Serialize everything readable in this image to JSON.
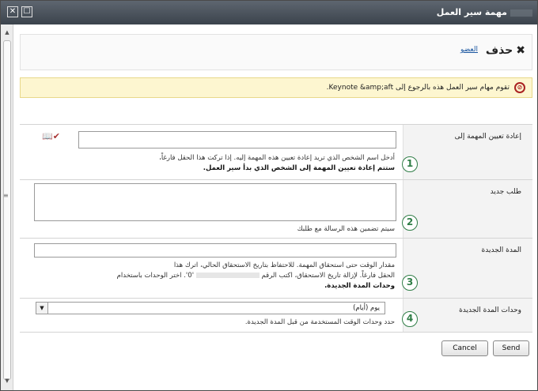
{
  "window": {
    "title": "مهمة سير العمل",
    "close_glyph": "✕",
    "max_glyph": "☐"
  },
  "ribbon": {
    "delete_label": "حذف",
    "member_link": "العضو"
  },
  "notice": {
    "text": "تقوم مهام سير العمل هذه بالرجوع إلى Keynote &amp;aft."
  },
  "form": {
    "reassign": {
      "label": "إعادة تعيين المهمة إلى",
      "value": "",
      "help_line1": "أدخل اسم الشخص الذي تريد إعادة تعيين هذه المهمة إليه. إذا تركت هذا الحقل فارغاً،",
      "help_line2": "ستتم إعادة تعيين المهمة إلى الشخص الذي بدأ سير العمل.",
      "badge": "1"
    },
    "request": {
      "label": "طلب جديد",
      "value": "",
      "help": "سيتم تضمين هذه الرسالة مع طلبك",
      "badge": "2"
    },
    "new_duration": {
      "label": "المدة الجديدة",
      "value": "",
      "help_line1": "مقدار الوقت حتى استحقاق المهمة. للاحتفاظ بتاريخ الاستحقاق الحالي، اترك هذا",
      "help_line2a": "الحقل فارغاً. لإزالة تاريخ الاستحقاق، اكتب الرقم",
      "help_line2b": "'0'. اختر الوحدات باستخدام",
      "help_line3": "وحدات المدة الجديدة.",
      "badge": "3"
    },
    "duration_units": {
      "label": "وحدات المدة الجديدة",
      "selected": "يوم (أيام)",
      "help": "حدد وحدات الوقت المستخدمة من قبل المدة الجديدة.",
      "badge": "4"
    }
  },
  "buttons": {
    "send": "Send",
    "cancel": "Cancel"
  }
}
